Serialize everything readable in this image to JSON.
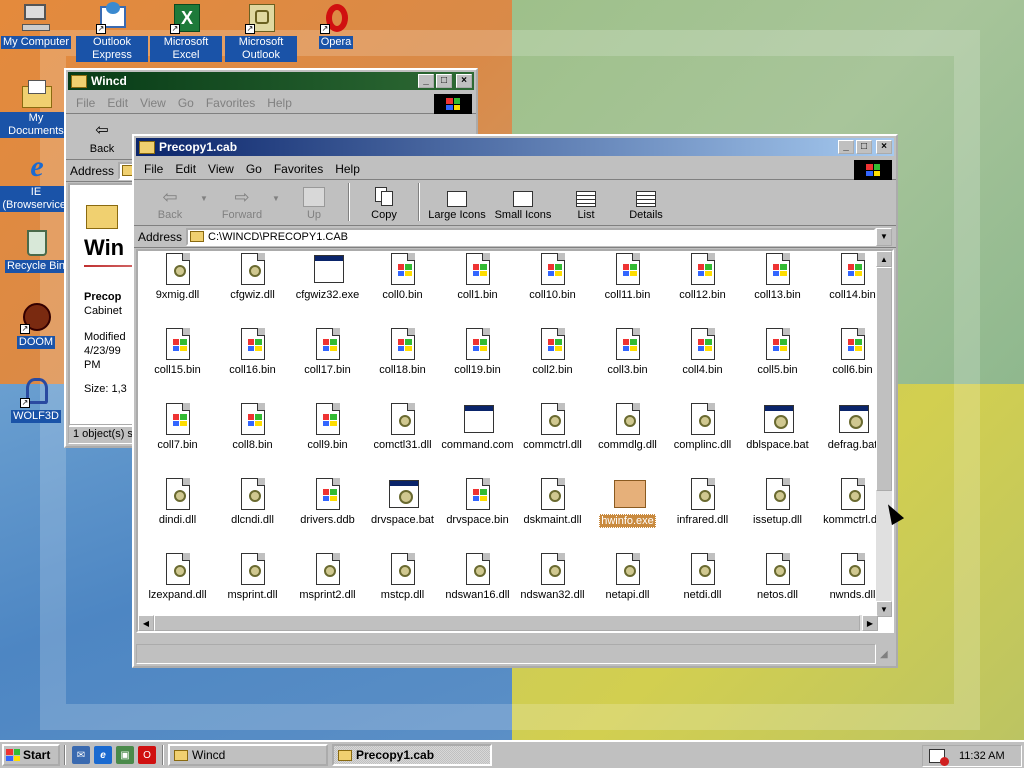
{
  "desktop": {
    "icons": [
      {
        "label": "My Computer",
        "icon": "my-computer-icon"
      },
      {
        "label": "Outlook Express",
        "icon": "outlook-express-icon"
      },
      {
        "label": "Microsoft Excel",
        "icon": "excel-icon"
      },
      {
        "label": "Microsoft Outlook",
        "icon": "outlook-icon"
      },
      {
        "label": "Opera",
        "icon": "opera-icon"
      },
      {
        "label": "My Documents",
        "icon": "my-documents-icon"
      },
      {
        "label": "IE (Browservice)",
        "icon": "internet-explorer-icon"
      },
      {
        "label": "Recycle Bin",
        "icon": "recycle-bin-icon"
      },
      {
        "label": "DOOM",
        "icon": "doom-icon"
      },
      {
        "label": "WOLF3D",
        "icon": "wolf3d-icon"
      }
    ]
  },
  "wincd_window": {
    "title": "Wincd",
    "menus": [
      "File",
      "Edit",
      "View",
      "Go",
      "Favorites",
      "Help"
    ],
    "back_label": "Back",
    "address_label": "Address",
    "heading": "Win",
    "info_name": "Precop",
    "info_type": "Cabinet",
    "info_modified_label": "Modified",
    "info_modified_date": "4/23/99",
    "info_modified_time": "PM",
    "info_size": "Size: 1,3",
    "status": "1 object(s) se"
  },
  "main_window": {
    "title": "Precopy1.cab",
    "menus": [
      "File",
      "Edit",
      "View",
      "Go",
      "Favorites",
      "Help"
    ],
    "toolbar": {
      "back": "Back",
      "forward": "Forward",
      "up": "Up",
      "copy": "Copy",
      "large_icons": "Large Icons",
      "small_icons": "Small Icons",
      "list": "List",
      "details": "Details"
    },
    "address_label": "Address",
    "address_value": "C:\\WINCD\\PRECOPY1.CAB",
    "selected_file": "hwinfo.exe",
    "files": [
      {
        "name": "9xmig.dll",
        "kind": "dll"
      },
      {
        "name": "cfgwiz.dll",
        "kind": "dll"
      },
      {
        "name": "cfgwiz32.exe",
        "kind": "exe"
      },
      {
        "name": "coll0.bin",
        "kind": "bin"
      },
      {
        "name": "coll1.bin",
        "kind": "bin"
      },
      {
        "name": "coll10.bin",
        "kind": "bin"
      },
      {
        "name": "coll11.bin",
        "kind": "bin"
      },
      {
        "name": "coll12.bin",
        "kind": "bin"
      },
      {
        "name": "coll13.bin",
        "kind": "bin"
      },
      {
        "name": "coll14.bin",
        "kind": "bin"
      },
      {
        "name": "coll15.bin",
        "kind": "bin"
      },
      {
        "name": "coll16.bin",
        "kind": "bin"
      },
      {
        "name": "coll17.bin",
        "kind": "bin"
      },
      {
        "name": "coll18.bin",
        "kind": "bin"
      },
      {
        "name": "coll19.bin",
        "kind": "bin"
      },
      {
        "name": "coll2.bin",
        "kind": "bin"
      },
      {
        "name": "coll3.bin",
        "kind": "bin"
      },
      {
        "name": "coll4.bin",
        "kind": "bin"
      },
      {
        "name": "coll5.bin",
        "kind": "bin"
      },
      {
        "name": "coll6.bin",
        "kind": "bin"
      },
      {
        "name": "coll7.bin",
        "kind": "bin"
      },
      {
        "name": "coll8.bin",
        "kind": "bin"
      },
      {
        "name": "coll9.bin",
        "kind": "bin"
      },
      {
        "name": "comctl31.dll",
        "kind": "dll"
      },
      {
        "name": "command.com",
        "kind": "exe"
      },
      {
        "name": "commctrl.dll",
        "kind": "dll"
      },
      {
        "name": "commdlg.dll",
        "kind": "dll"
      },
      {
        "name": "complinc.dll",
        "kind": "dll"
      },
      {
        "name": "dblspace.bat",
        "kind": "bat"
      },
      {
        "name": "defrag.bat",
        "kind": "bat"
      },
      {
        "name": "dindi.dll",
        "kind": "dll"
      },
      {
        "name": "dlcndi.dll",
        "kind": "dll"
      },
      {
        "name": "drivers.ddb",
        "kind": "bin"
      },
      {
        "name": "drvspace.bat",
        "kind": "bat"
      },
      {
        "name": "drvspace.bin",
        "kind": "bin"
      },
      {
        "name": "dskmaint.dll",
        "kind": "dll"
      },
      {
        "name": "hwinfo.exe",
        "kind": "orange"
      },
      {
        "name": "infrared.dll",
        "kind": "dll"
      },
      {
        "name": "issetup.dll",
        "kind": "dll"
      },
      {
        "name": "kommctrl.dll",
        "kind": "dll"
      },
      {
        "name": "lzexpand.dll",
        "kind": "dll"
      },
      {
        "name": "msprint.dll",
        "kind": "dll"
      },
      {
        "name": "msprint2.dll",
        "kind": "dll"
      },
      {
        "name": "mstcp.dll",
        "kind": "dll"
      },
      {
        "name": "ndswan16.dll",
        "kind": "dll"
      },
      {
        "name": "ndswan32.dll",
        "kind": "dll"
      },
      {
        "name": "netapi.dll",
        "kind": "dll"
      },
      {
        "name": "netdi.dll",
        "kind": "dll"
      },
      {
        "name": "netos.dll",
        "kind": "dll"
      },
      {
        "name": "nwnds.dll",
        "kind": "dll"
      }
    ]
  },
  "taskbar": {
    "start_label": "Start",
    "quicklaunch": [
      "outlook-express-icon",
      "internet-explorer-icon",
      "show-desktop-icon",
      "opera-icon"
    ],
    "tasks": [
      "Wincd",
      "Precopy1.cab"
    ],
    "clock": "11:32 AM"
  },
  "colors": {
    "active_title": "#0a246a",
    "inactive_title": "#073b17",
    "selection": "#c98a3e",
    "face": "#c0c0c0"
  }
}
